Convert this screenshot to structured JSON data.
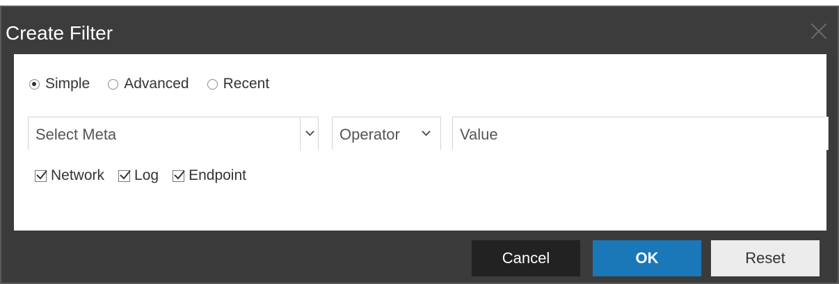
{
  "dialog": {
    "title": "Create Filter",
    "close_icon": "close-icon"
  },
  "mode": {
    "options": [
      {
        "label": "Simple",
        "checked": true
      },
      {
        "label": "Advanced",
        "checked": false
      },
      {
        "label": "Recent",
        "checked": false
      }
    ]
  },
  "fields": {
    "meta_placeholder": "Select Meta",
    "operator_label": "Operator",
    "value_placeholder": "Value"
  },
  "sources": {
    "items": [
      {
        "label": "Network",
        "checked": true
      },
      {
        "label": "Log",
        "checked": true
      },
      {
        "label": "Endpoint",
        "checked": true
      }
    ]
  },
  "buttons": {
    "cancel": "Cancel",
    "ok": "OK",
    "reset": "Reset"
  },
  "colors": {
    "ok_blue": "#1a78b8",
    "cancel_dark": "#222222",
    "dialog_bg": "#3b3b3b"
  }
}
